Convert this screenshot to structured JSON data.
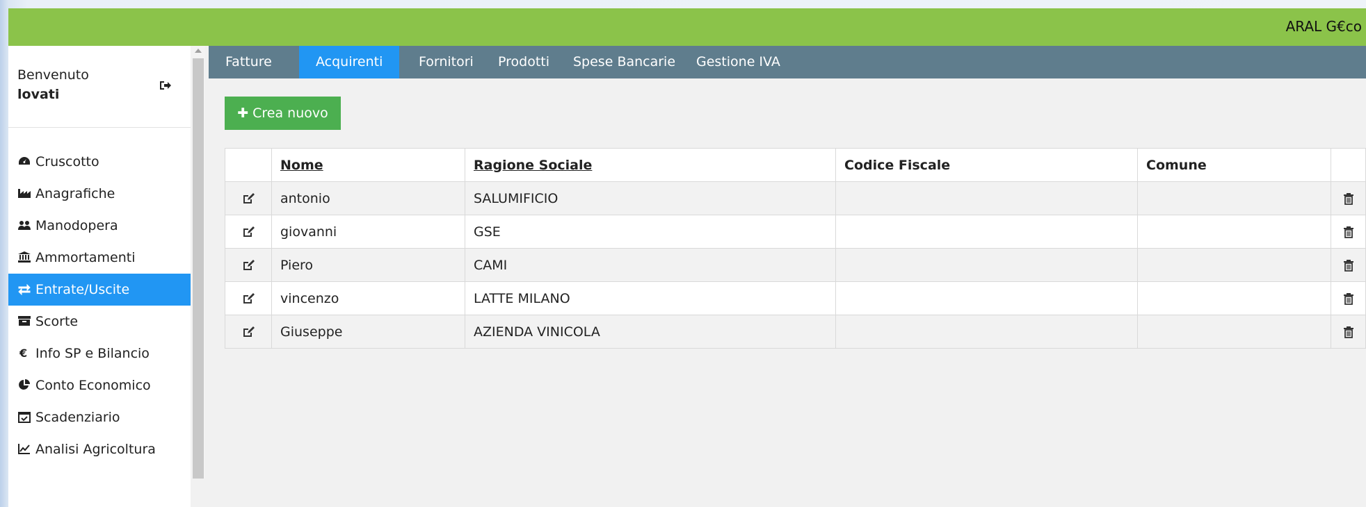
{
  "app": {
    "brand": "ARAL G€co"
  },
  "user": {
    "greeting": "Benvenuto",
    "name": "lovati"
  },
  "nav": [
    {
      "label": "Cruscotto",
      "icon": "dashboard-icon"
    },
    {
      "label": "Anagrafiche",
      "icon": "industry-icon"
    },
    {
      "label": "Manodopera",
      "icon": "users-icon"
    },
    {
      "label": "Ammortamenti",
      "icon": "bank-icon"
    },
    {
      "label": "Entrate/Uscite",
      "icon": "exchange-icon",
      "active": true
    },
    {
      "label": "Scorte",
      "icon": "archive-icon"
    },
    {
      "label": "Info SP e Bilancio",
      "icon": "euro-icon"
    },
    {
      "label": "Conto Economico",
      "icon": "pie-chart-icon"
    },
    {
      "label": "Scadenziario",
      "icon": "calendar-check-icon"
    },
    {
      "label": "Analisi Agricoltura",
      "icon": "line-chart-icon"
    }
  ],
  "tabs": [
    {
      "label": "Fatture"
    },
    {
      "label": "Acquirenti",
      "active": true
    },
    {
      "label": "Fornitori"
    },
    {
      "label": "Prodotti"
    },
    {
      "label": "Spese Bancarie"
    },
    {
      "label": "Gestione IVA"
    }
  ],
  "toolbar": {
    "create_label": "Crea nuovo"
  },
  "table": {
    "columns": [
      "Nome",
      "Ragione Sociale",
      "Codice Fiscale",
      "Comune"
    ],
    "rows": [
      {
        "nome": "antonio",
        "ragione_sociale": "SALUMIFICIO",
        "codice_fiscale": "",
        "comune": ""
      },
      {
        "nome": "giovanni",
        "ragione_sociale": "GSE",
        "codice_fiscale": "",
        "comune": ""
      },
      {
        "nome": "Piero",
        "ragione_sociale": "CAMI",
        "codice_fiscale": "",
        "comune": ""
      },
      {
        "nome": "vincenzo",
        "ragione_sociale": "LATTE MILANO",
        "codice_fiscale": "",
        "comune": ""
      },
      {
        "nome": "Giuseppe",
        "ragione_sociale": "AZIENDA VINICOLA",
        "codice_fiscale": "",
        "comune": ""
      }
    ]
  },
  "colors": {
    "topbar": "#8bc34a",
    "tabs": "#5f7d8d",
    "active": "#2196f3",
    "create": "#4caf50"
  }
}
